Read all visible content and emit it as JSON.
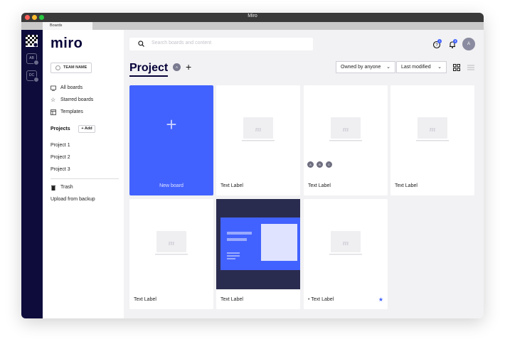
{
  "window": {
    "title": "Miro",
    "tab": "Boards"
  },
  "rail": {
    "avatars": [
      "AB",
      "DC"
    ]
  },
  "sidebar": {
    "brand": "miro",
    "team_button": "TEAM NAME",
    "nav": [
      {
        "label": "All boards",
        "icon": "monitor-icon"
      },
      {
        "label": "Starred boards",
        "icon": "star-outline-icon"
      },
      {
        "label": "Templates",
        "icon": "template-icon"
      }
    ],
    "projects_title": "Projects",
    "add_label": "+ Add",
    "projects": [
      "Project 1",
      "Project 2",
      "Project 3"
    ],
    "trash": "Trash",
    "upload": "Upload from backup"
  },
  "header": {
    "search_placeholder": "Search boards and content",
    "help_badge": "1",
    "notif_badge": "3",
    "user_avatar": "A"
  },
  "content": {
    "title": "Project",
    "project_avatar": "A",
    "add": "+",
    "owner_filter": "Owned by anyone",
    "sort": "Last modified"
  },
  "boards": [
    {
      "label": "New board"
    },
    {
      "label": "Text Label"
    },
    {
      "label": "Text Label",
      "avatars": [
        "A",
        "B",
        "C"
      ]
    },
    {
      "label": "Text Label"
    },
    {
      "label": "Text Label"
    },
    {
      "label": "Text Label"
    },
    {
      "label": "Text Label",
      "starred": true
    }
  ],
  "colors": {
    "accent": "#4262ff",
    "rail": "#0d0c3b",
    "dark_thumb": "#2a2c4f"
  }
}
